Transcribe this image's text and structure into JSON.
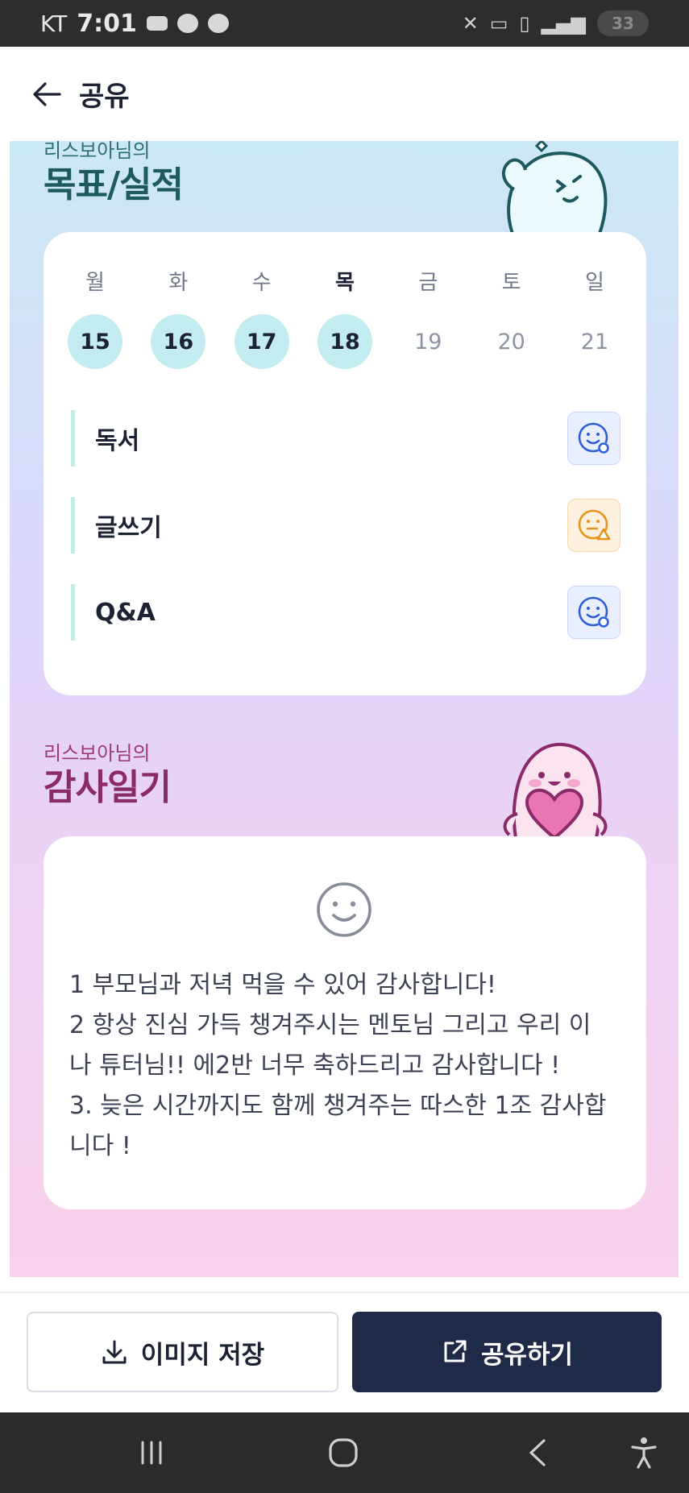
{
  "status_bar": {
    "carrier": "KT",
    "time": "7:01",
    "battery": "33"
  },
  "header": {
    "title": "공유"
  },
  "goals_section": {
    "subtitle": "리스보아님의",
    "title": "목표/실적",
    "days": [
      {
        "name": "월",
        "date": "15",
        "done": true,
        "today": false
      },
      {
        "name": "화",
        "date": "16",
        "done": true,
        "today": false
      },
      {
        "name": "수",
        "date": "17",
        "done": true,
        "today": false
      },
      {
        "name": "목",
        "date": "18",
        "done": true,
        "today": true
      },
      {
        "name": "금",
        "date": "19",
        "done": false,
        "today": false
      },
      {
        "name": "토",
        "date": "20",
        "done": false,
        "today": false
      },
      {
        "name": "일",
        "date": "21",
        "done": false,
        "today": false
      }
    ],
    "goals": [
      {
        "label": "독서",
        "status_icon": "smile-check-icon"
      },
      {
        "label": "글쓰기",
        "status_icon": "neutral-warning-icon"
      },
      {
        "label": "Q&A",
        "status_icon": "smile-check-icon"
      }
    ]
  },
  "diary_section": {
    "subtitle": "리스보아님의",
    "title": "감사일기",
    "text": "1 부모님과 저녁 먹을 수 있어 감사합니다!\n2 항상 진심 가득 챙겨주시는 멘토님 그리고 우리 이\n나 튜터님!! 에2반 너무 축하드리고 감사합니다 !\n3. 늦은 시간까지도 함께 챙겨주는 따스한 1조 감사합\n니다 !"
  },
  "actions": {
    "save_label": "이미지 저장",
    "share_label": "공유하기"
  },
  "colors": {
    "primary_dark": "#1e2a48",
    "done_circle": "#c3ecf1",
    "good_icon": "#2f5fd6",
    "warn_icon": "#e8951f",
    "goal_title": "#1e5960",
    "diary_title": "#8a2a68"
  }
}
